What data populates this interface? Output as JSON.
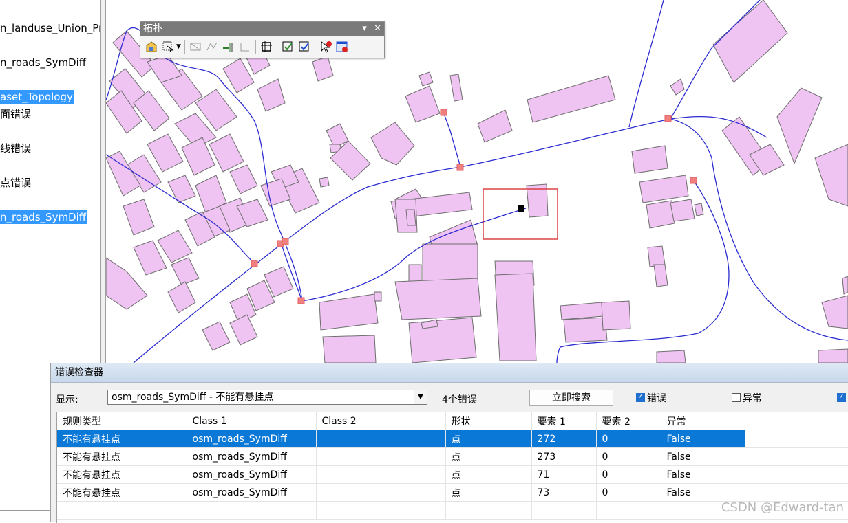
{
  "toc": {
    "layers": [
      {
        "label": "n_landuse_Union_Pro",
        "selected": false
      },
      {
        "label": "n_roads_SymDiff",
        "selected": false
      },
      {
        "label": "aset_Topology",
        "selected": true
      },
      {
        "label": "面错误",
        "selected": false
      },
      {
        "label": "线错误",
        "selected": false
      },
      {
        "label": "点错误",
        "selected": false
      },
      {
        "label": "n_roads_SymDiff",
        "selected": true
      }
    ]
  },
  "toolbar": {
    "title": "拓扑",
    "menu_glyph": "▾",
    "close_glyph": "✕"
  },
  "inspector": {
    "title": "错误检查器",
    "show_label": "显示:",
    "show_value": "osm_roads_SymDiff - 不能有悬挂点",
    "error_count": "4个错误",
    "search_button": "立即搜索",
    "errors_checkbox": {
      "label": "错误",
      "checked": true
    },
    "exceptions_checkbox": {
      "label": "异常",
      "checked": false
    },
    "columns": [
      "规则类型",
      "Class 1",
      "Class 2",
      "形状",
      "要素 1",
      "要素 2",
      "异常"
    ],
    "rows": [
      {
        "rule": "不能有悬挂点",
        "class1": "osm_roads_SymDiff",
        "class2": "",
        "shape": "点",
        "feature1": "272",
        "feature2": "0",
        "exception": "False",
        "selected": true
      },
      {
        "rule": "不能有悬挂点",
        "class1": "osm_roads_SymDiff",
        "class2": "",
        "shape": "点",
        "feature1": "273",
        "feature2": "0",
        "exception": "False",
        "selected": false
      },
      {
        "rule": "不能有悬挂点",
        "class1": "osm_roads_SymDiff",
        "class2": "",
        "shape": "点",
        "feature1": "71",
        "feature2": "0",
        "exception": "False",
        "selected": false
      },
      {
        "rule": "不能有悬挂点",
        "class1": "osm_roads_SymDiff",
        "class2": "",
        "shape": "点",
        "feature1": "73",
        "feature2": "0",
        "exception": "False",
        "selected": false
      }
    ]
  },
  "colors": {
    "building_fill": "#efc3f2",
    "building_stroke": "#6e6e6e",
    "road": "#2b2bd1",
    "error_marker": "#f08080",
    "selection_box": "#d62828",
    "highlight": "#0a78d7"
  },
  "watermark": "CSDN @Edward-tan"
}
